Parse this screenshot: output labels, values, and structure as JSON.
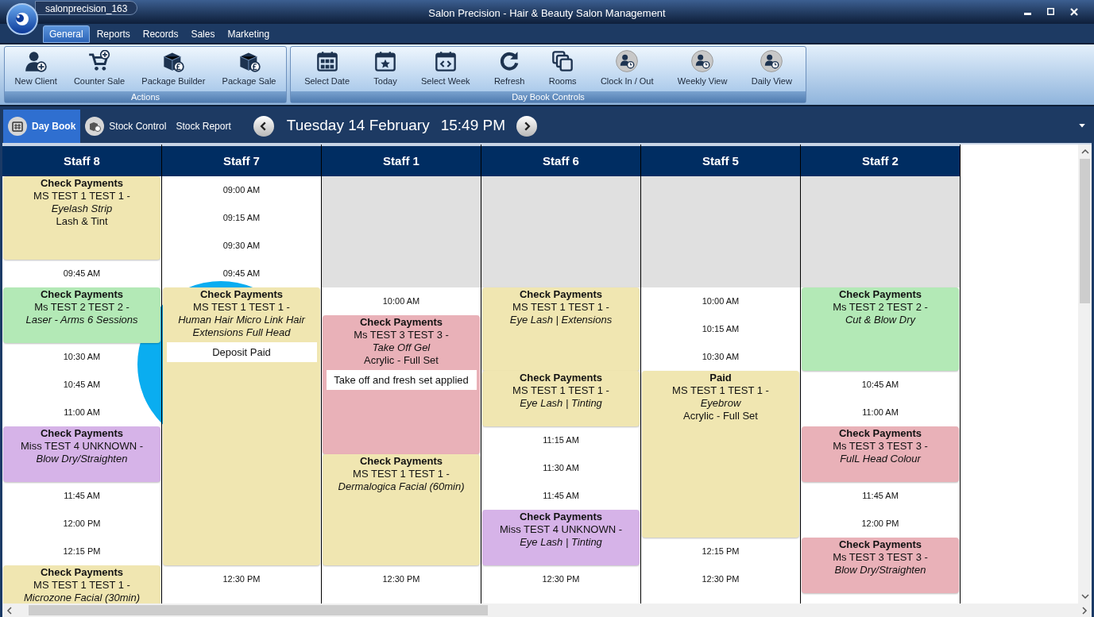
{
  "window": {
    "account": "salonprecision_163",
    "title": "Salon Precision - Hair & Beauty Salon Management"
  },
  "tabs": [
    {
      "label": "General",
      "selected": true
    },
    {
      "label": "Reports",
      "selected": false
    },
    {
      "label": "Records",
      "selected": false
    },
    {
      "label": "Sales",
      "selected": false
    },
    {
      "label": "Marketing",
      "selected": false
    }
  ],
  "ribbon_groups": [
    {
      "label": "Actions",
      "buttons": [
        {
          "label": "New Client"
        },
        {
          "label": "Counter Sale"
        },
        {
          "label": "Package Builder"
        },
        {
          "label": "Package Sale"
        }
      ]
    },
    {
      "label": "Day Book Controls",
      "buttons": [
        {
          "label": "Select Date"
        },
        {
          "label": "Today"
        },
        {
          "label": "Select Week"
        },
        {
          "label": "Refresh"
        },
        {
          "label": "Rooms"
        },
        {
          "label": "Clock In / Out"
        },
        {
          "label": "Weekly View"
        },
        {
          "label": "Daily View"
        }
      ]
    }
  ],
  "nav": {
    "items": [
      {
        "label": "Day Book",
        "selected": true
      },
      {
        "label": "Stock Control",
        "selected": false
      },
      {
        "label": "Stock Report",
        "selected": false
      }
    ],
    "date": "Tuesday 14 February",
    "time": "15:49 PM"
  },
  "staff": [
    {
      "name": "Staff 8",
      "blocks": [
        {
          "kind": "appointment",
          "color": "#f0e6b1",
          "title": "Check Payments",
          "client": "MS TEST 1 TEST 1 -",
          "service": "Eyelash Strip",
          "extra": "Lash & Tint"
        },
        {
          "kind": "continued"
        },
        {
          "kind": "continued"
        },
        {
          "kind": "time",
          "label": "09:45 AM"
        },
        {
          "kind": "appointment",
          "color": "#b3e9b6",
          "title": "Check Payments",
          "client": "Ms TEST 2 TEST 2 -",
          "service": "Laser - Arms 6 Sessions"
        },
        {
          "kind": "continued"
        },
        {
          "kind": "time",
          "label": "10:30 AM"
        },
        {
          "kind": "time",
          "label": "10:45 AM"
        },
        {
          "kind": "time",
          "label": "11:00 AM"
        },
        {
          "kind": "appointment",
          "color": "#d6b3e8",
          "title": "Check Payments",
          "client": "Miss TEST 4 UNKNOWN -",
          "service": "Blow Dry/Straighten"
        },
        {
          "kind": "continued"
        },
        {
          "kind": "time",
          "label": "11:45 AM"
        },
        {
          "kind": "time",
          "label": "12:00 PM"
        },
        {
          "kind": "time",
          "label": "12:15 PM"
        },
        {
          "kind": "appointment",
          "color": "#f0e6b1",
          "title": "Check Payments",
          "client": "MS TEST 1 TEST 1 -",
          "service": "Microzone Facial (30min)"
        },
        {
          "kind": "continued"
        }
      ]
    },
    {
      "name": "Staff 7",
      "blocks": [
        {
          "kind": "time",
          "label": "09:00 AM"
        },
        {
          "kind": "time",
          "label": "09:15 AM"
        },
        {
          "kind": "time",
          "label": "09:30 AM"
        },
        {
          "kind": "time",
          "label": "09:45 AM"
        },
        {
          "kind": "appointment",
          "color": "#f0e6b1",
          "title": "Check Payments",
          "client": "MS TEST 1 TEST 1 -",
          "service": "Human Hair Micro Link Hair Extensions Full Head",
          "note": "Deposit Paid"
        },
        {
          "kind": "continued"
        },
        {
          "kind": "continued"
        },
        {
          "kind": "continued"
        },
        {
          "kind": "continued"
        },
        {
          "kind": "continued"
        },
        {
          "kind": "continued"
        },
        {
          "kind": "continued"
        },
        {
          "kind": "continued"
        },
        {
          "kind": "continued"
        },
        {
          "kind": "time",
          "label": "12:30 PM"
        }
      ]
    },
    {
      "name": "Staff 1",
      "blocks": [
        {
          "kind": "closed"
        },
        {
          "kind": "closed"
        },
        {
          "kind": "closed"
        },
        {
          "kind": "closed"
        },
        {
          "kind": "time",
          "label": "10:00 AM"
        },
        {
          "kind": "appointment",
          "color": "#e9b1b8",
          "title": "Check Payments",
          "client": "Ms TEST 3 TEST 3 -",
          "service": "Take Off Gel",
          "extra": "Acrylic - Full Set",
          "note": "Take off and fresh set applied"
        },
        {
          "kind": "continued"
        },
        {
          "kind": "continued"
        },
        {
          "kind": "continued"
        },
        {
          "kind": "continued"
        },
        {
          "kind": "appointment",
          "color": "#f0e6b1",
          "title": "Check Payments",
          "client": "MS TEST 1 TEST 1 -",
          "service": "Dermalogica Facial (60min)"
        },
        {
          "kind": "continued"
        },
        {
          "kind": "continued"
        },
        {
          "kind": "continued"
        },
        {
          "kind": "time",
          "label": "12:30 PM"
        }
      ]
    },
    {
      "name": "Staff 6",
      "blocks": [
        {
          "kind": "closed"
        },
        {
          "kind": "closed"
        },
        {
          "kind": "closed"
        },
        {
          "kind": "closed"
        },
        {
          "kind": "appointment",
          "color": "#f0e6b1",
          "title": "Check Payments",
          "client": "MS TEST 1 TEST 1 -",
          "service": "Eye Lash | Extensions"
        },
        {
          "kind": "continued"
        },
        {
          "kind": "continued"
        },
        {
          "kind": "appointment",
          "color": "#f0e6b1",
          "title": "Check Payments",
          "client": "MS TEST 1 TEST 1 -",
          "service": "Eye Lash | Tinting"
        },
        {
          "kind": "continued"
        },
        {
          "kind": "time",
          "label": "11:15 AM"
        },
        {
          "kind": "time",
          "label": "11:30 AM"
        },
        {
          "kind": "time",
          "label": "11:45 AM"
        },
        {
          "kind": "appointment",
          "color": "#d6b3e8",
          "title": "Check Payments",
          "client": "Miss TEST 4 UNKNOWN -",
          "service": "Eye Lash | Tinting"
        },
        {
          "kind": "continued"
        },
        {
          "kind": "time",
          "label": "12:30 PM"
        }
      ]
    },
    {
      "name": "Staff 5",
      "blocks": [
        {
          "kind": "closed"
        },
        {
          "kind": "closed"
        },
        {
          "kind": "closed"
        },
        {
          "kind": "closed"
        },
        {
          "kind": "time",
          "label": "10:00 AM"
        },
        {
          "kind": "time",
          "label": "10:15 AM"
        },
        {
          "kind": "time",
          "label": "10:30 AM"
        },
        {
          "kind": "appointment",
          "color": "#f0e6b1",
          "title": "Paid",
          "client": "MS TEST 1 TEST 1 -",
          "service": "Eyebrow",
          "extra": "Acrylic - Full Set"
        },
        {
          "kind": "continued"
        },
        {
          "kind": "continued"
        },
        {
          "kind": "continued"
        },
        {
          "kind": "continued"
        },
        {
          "kind": "continued"
        },
        {
          "kind": "time",
          "label": "12:15 PM"
        },
        {
          "kind": "time",
          "label": "12:30 PM"
        }
      ]
    },
    {
      "name": "Staff 2",
      "blocks": [
        {
          "kind": "closed"
        },
        {
          "kind": "closed"
        },
        {
          "kind": "closed"
        },
        {
          "kind": "closed"
        },
        {
          "kind": "appointment",
          "color": "#b3e9b6",
          "title": "Check Payments",
          "client": "Ms TEST 2 TEST 2 -",
          "service": "Cut & Blow Dry"
        },
        {
          "kind": "continued"
        },
        {
          "kind": "continued"
        },
        {
          "kind": "time",
          "label": "10:45 AM"
        },
        {
          "kind": "time",
          "label": "11:00 AM"
        },
        {
          "kind": "appointment",
          "color": "#e9b1b8",
          "title": "Check Payments",
          "client": "Ms TEST 3 TEST 3 -",
          "service": "FulL Head Colour"
        },
        {
          "kind": "continued"
        },
        {
          "kind": "time",
          "label": "11:45 AM"
        },
        {
          "kind": "time",
          "label": "12:00 PM"
        },
        {
          "kind": "appointment",
          "color": "#e9b1b8",
          "title": "Check Payments",
          "client": "Ms TEST 3 TEST 3 -",
          "service": "Blow Dry/Straighten"
        },
        {
          "kind": "continued"
        }
      ]
    }
  ]
}
